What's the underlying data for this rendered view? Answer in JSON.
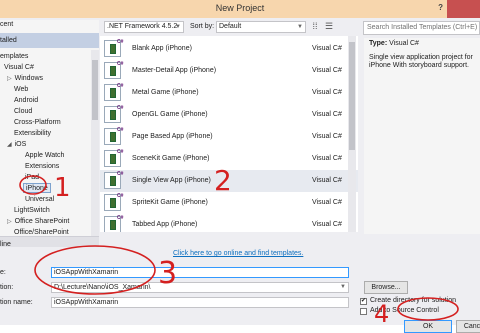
{
  "window": {
    "title": "New Project",
    "help_glyph": "?"
  },
  "sidebar": {
    "recent": "cent",
    "installed": "talled",
    "templates": "emplates",
    "visual_csharp": "Visual C#",
    "items": [
      "Windows",
      "Web",
      "Android",
      "Cloud",
      "Cross-Platform",
      "Extensibility",
      "iOS",
      "Apple Watch",
      "Extensions",
      "iPad",
      "iPhone",
      "Universal",
      "LightSwitch",
      "Office SharePoint",
      "Office/SharePoint"
    ],
    "online": "line"
  },
  "toolbar": {
    "framework": ".NET Framework 4.5.2",
    "sort_label": "Sort by:",
    "sort_value": "Default",
    "search_placeholder": "Search Installed Templates (Ctrl+E)"
  },
  "templates": [
    {
      "name": "Blank App (iPhone)",
      "lang": "Visual C#"
    },
    {
      "name": "Master-Detail App (iPhone)",
      "lang": "Visual C#"
    },
    {
      "name": "Metal Game (iPhone)",
      "lang": "Visual C#"
    },
    {
      "name": "OpenGL Game (iPhone)",
      "lang": "Visual C#"
    },
    {
      "name": "Page Based App (iPhone)",
      "lang": "Visual C#"
    },
    {
      "name": "SceneKit Game (iPhone)",
      "lang": "Visual C#"
    },
    {
      "name": "Single View App (iPhone)",
      "lang": "Visual C#"
    },
    {
      "name": "SpriteKit Game (iPhone)",
      "lang": "Visual C#"
    },
    {
      "name": "Tabbed App (iPhone)",
      "lang": "Visual C#"
    }
  ],
  "online_link": "Click here to go online and find templates.",
  "details": {
    "type_label": "Type:",
    "type_value": "Visual C#",
    "description": "Single view application project for iPhone With storyboard support."
  },
  "form": {
    "name_label": "e:",
    "name_value": "iOSAppWithXamarin",
    "location_label": "tion:",
    "location_value": "D:\\Lecture\\Nano\\iOS_Xamarin\\",
    "solution_label": "tion name:",
    "solution_value": "iOSAppWithXamarin",
    "browse": "Browse...",
    "create_dir": "Create directory for solution",
    "source_control": "Add to Source Control",
    "ok": "OK",
    "cancel": "Canc"
  },
  "annotations": [
    "1",
    "2",
    "3",
    "4"
  ],
  "colors": {
    "annotation": "#d42020",
    "title_bar": "#f7d6ad",
    "link": "#0e70c0",
    "selection": "#c3cfe3"
  }
}
